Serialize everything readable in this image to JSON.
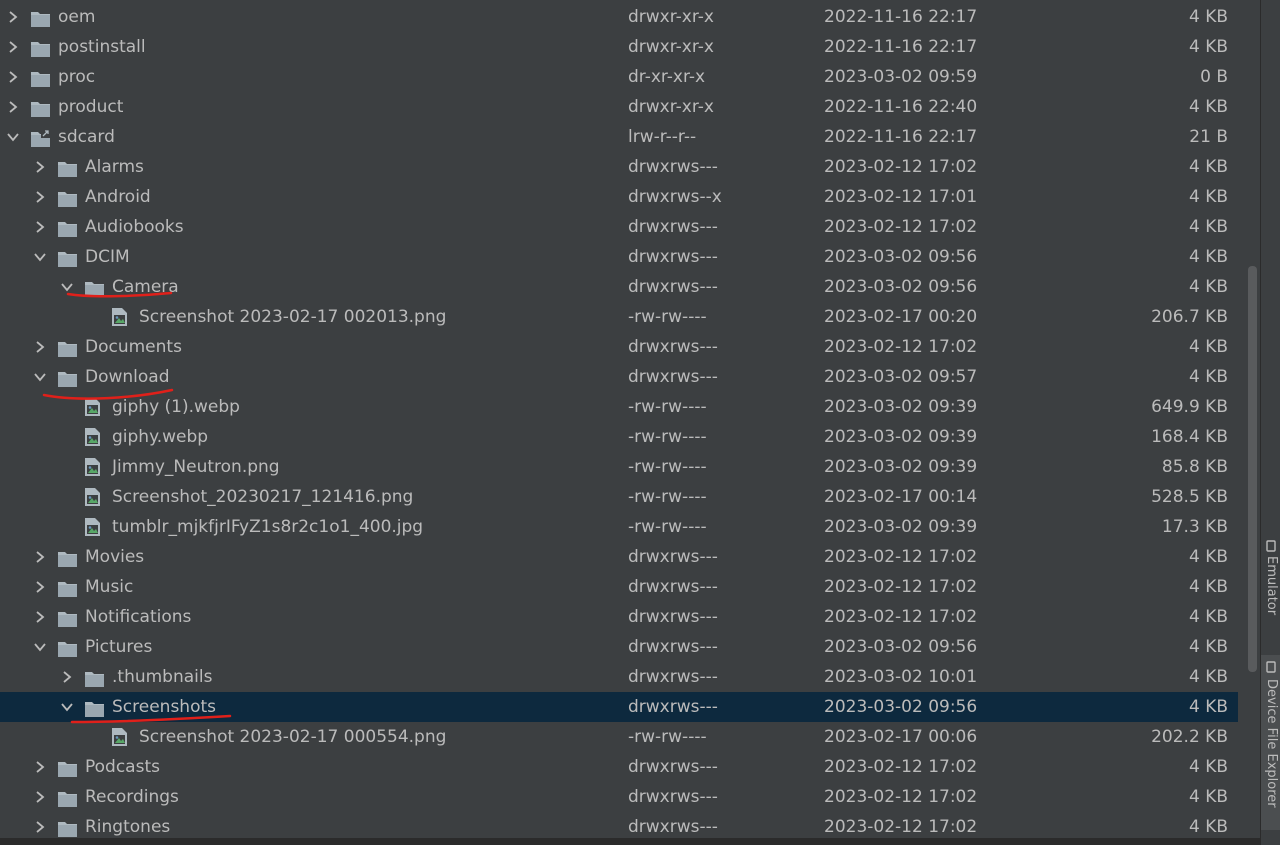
{
  "rows": [
    {
      "name": "oem",
      "depth": 0,
      "type": "folder",
      "state": "collapsed",
      "perm": "drwxr-xr-x",
      "date": "2022-11-16 22:17",
      "size": "4 KB"
    },
    {
      "name": "postinstall",
      "depth": 0,
      "type": "folder",
      "state": "collapsed",
      "perm": "drwxr-xr-x",
      "date": "2022-11-16 22:17",
      "size": "4 KB"
    },
    {
      "name": "proc",
      "depth": 0,
      "type": "folder",
      "state": "collapsed",
      "perm": "dr-xr-xr-x",
      "date": "2023-03-02 09:59",
      "size": "0 B"
    },
    {
      "name": "product",
      "depth": 0,
      "type": "folder",
      "state": "collapsed",
      "perm": "drwxr-xr-x",
      "date": "2022-11-16 22:40",
      "size": "4 KB"
    },
    {
      "name": "sdcard",
      "depth": 0,
      "type": "link",
      "state": "expanded",
      "perm": "lrw-r--r--",
      "date": "2022-11-16 22:17",
      "size": "21 B"
    },
    {
      "name": "Alarms",
      "depth": 1,
      "type": "folder",
      "state": "collapsed",
      "perm": "drwxrws---",
      "date": "2023-02-12 17:02",
      "size": "4 KB"
    },
    {
      "name": "Android",
      "depth": 1,
      "type": "folder",
      "state": "collapsed",
      "perm": "drwxrws--x",
      "date": "2023-02-12 17:01",
      "size": "4 KB"
    },
    {
      "name": "Audiobooks",
      "depth": 1,
      "type": "folder",
      "state": "collapsed",
      "perm": "drwxrws---",
      "date": "2023-02-12 17:02",
      "size": "4 KB"
    },
    {
      "name": "DCIM",
      "depth": 1,
      "type": "folder",
      "state": "expanded",
      "perm": "drwxrws---",
      "date": "2023-03-02 09:56",
      "size": "4 KB"
    },
    {
      "name": "Camera",
      "depth": 2,
      "type": "folder",
      "state": "expanded",
      "perm": "drwxrws---",
      "date": "2023-03-02 09:56",
      "size": "4 KB"
    },
    {
      "name": "Screenshot 2023-02-17 002013.png",
      "depth": 3,
      "type": "image",
      "state": "none",
      "perm": "-rw-rw----",
      "date": "2023-02-17 00:20",
      "size": "206.7 KB"
    },
    {
      "name": "Documents",
      "depth": 1,
      "type": "folder",
      "state": "collapsed",
      "perm": "drwxrws---",
      "date": "2023-02-12 17:02",
      "size": "4 KB"
    },
    {
      "name": "Download",
      "depth": 1,
      "type": "folder",
      "state": "expanded",
      "perm": "drwxrws---",
      "date": "2023-03-02 09:57",
      "size": "4 KB"
    },
    {
      "name": "giphy (1).webp",
      "depth": 2,
      "type": "image",
      "state": "none",
      "perm": "-rw-rw----",
      "date": "2023-03-02 09:39",
      "size": "649.9 KB"
    },
    {
      "name": "giphy.webp",
      "depth": 2,
      "type": "image",
      "state": "none",
      "perm": "-rw-rw----",
      "date": "2023-03-02 09:39",
      "size": "168.4 KB"
    },
    {
      "name": "Jimmy_Neutron.png",
      "depth": 2,
      "type": "image",
      "state": "none",
      "perm": "-rw-rw----",
      "date": "2023-03-02 09:39",
      "size": "85.8 KB"
    },
    {
      "name": "Screenshot_20230217_121416.png",
      "depth": 2,
      "type": "image",
      "state": "none",
      "perm": "-rw-rw----",
      "date": "2023-02-17 00:14",
      "size": "528.5 KB"
    },
    {
      "name": "tumblr_mjkfjrIFyZ1s8r2c1o1_400.jpg",
      "depth": 2,
      "type": "image",
      "state": "none",
      "perm": "-rw-rw----",
      "date": "2023-03-02 09:39",
      "size": "17.3 KB"
    },
    {
      "name": "Movies",
      "depth": 1,
      "type": "folder",
      "state": "collapsed",
      "perm": "drwxrws---",
      "date": "2023-02-12 17:02",
      "size": "4 KB"
    },
    {
      "name": "Music",
      "depth": 1,
      "type": "folder",
      "state": "collapsed",
      "perm": "drwxrws---",
      "date": "2023-02-12 17:02",
      "size": "4 KB"
    },
    {
      "name": "Notifications",
      "depth": 1,
      "type": "folder",
      "state": "collapsed",
      "perm": "drwxrws---",
      "date": "2023-02-12 17:02",
      "size": "4 KB"
    },
    {
      "name": "Pictures",
      "depth": 1,
      "type": "folder",
      "state": "expanded",
      "perm": "drwxrws---",
      "date": "2023-03-02 09:56",
      "size": "4 KB"
    },
    {
      "name": ".thumbnails",
      "depth": 2,
      "type": "folder",
      "state": "collapsed",
      "perm": "drwxrws---",
      "date": "2023-03-02 10:01",
      "size": "4 KB"
    },
    {
      "name": "Screenshots",
      "depth": 2,
      "type": "folder",
      "state": "expanded",
      "perm": "drwxrws---",
      "date": "2023-03-02 09:56",
      "size": "4 KB",
      "selected": true
    },
    {
      "name": "Screenshot 2023-02-17 000554.png",
      "depth": 3,
      "type": "image",
      "state": "none",
      "perm": "-rw-rw----",
      "date": "2023-02-17 00:06",
      "size": "202.2 KB"
    },
    {
      "name": "Podcasts",
      "depth": 1,
      "type": "folder",
      "state": "collapsed",
      "perm": "drwxrws---",
      "date": "2023-02-12 17:02",
      "size": "4 KB"
    },
    {
      "name": "Recordings",
      "depth": 1,
      "type": "folder",
      "state": "collapsed",
      "perm": "drwxrws---",
      "date": "2023-02-12 17:02",
      "size": "4 KB"
    },
    {
      "name": "Ringtones",
      "depth": 1,
      "type": "folder",
      "state": "collapsed",
      "perm": "drwxrws---",
      "date": "2023-02-12 17:02",
      "size": "4 KB"
    }
  ],
  "side_tabs": {
    "emulator": "Emulator",
    "device_file_explorer": "Device File Explorer"
  },
  "colors": {
    "background": "#3c3f41",
    "text": "#bbbbbb",
    "selected_row": "#0d293e",
    "folder_icon": "#aeb9c0",
    "annotation_ink": "#e0201a"
  },
  "icons": {
    "collapsed": "chevron-right-icon",
    "expanded": "chevron-down-icon",
    "folder": "folder-icon",
    "link": "folder-link-icon",
    "image": "image-file-icon"
  }
}
